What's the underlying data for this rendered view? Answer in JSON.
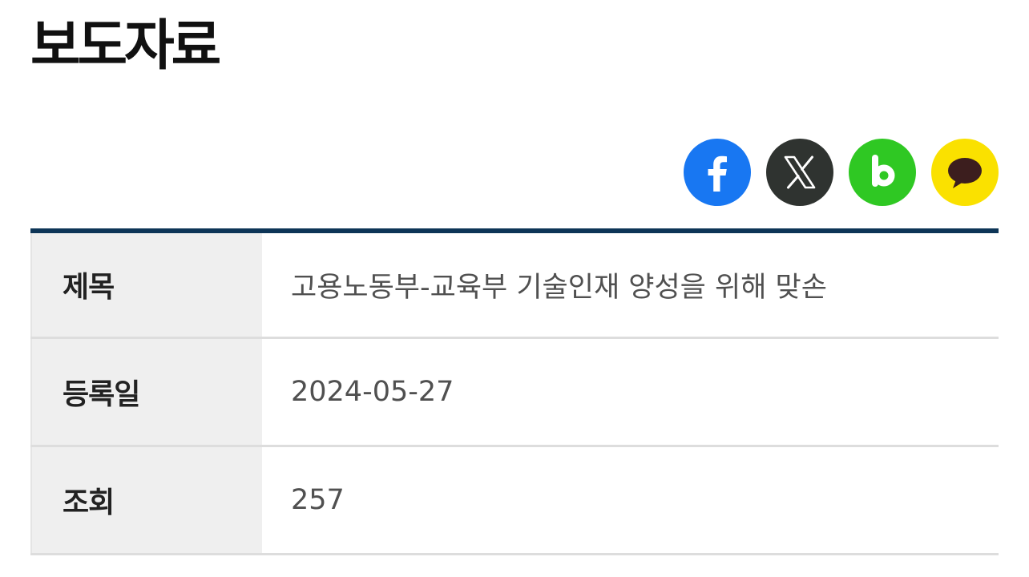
{
  "page": {
    "title": "보도자료"
  },
  "share": {
    "buttons": [
      {
        "name": "facebook",
        "icon": "facebook-icon",
        "color": "#1877f2"
      },
      {
        "name": "x",
        "icon": "x-icon",
        "color": "#2f3330"
      },
      {
        "name": "band",
        "icon": "band-icon",
        "color": "#2fc823"
      },
      {
        "name": "kakaotalk",
        "icon": "kakaotalk-icon",
        "color": "#fae100"
      }
    ]
  },
  "article": {
    "rows": [
      {
        "label": "제목",
        "value": "고용노동부-교육부 기술인재 양성을 위해 맞손"
      },
      {
        "label": "등록일",
        "value": "2024-05-27"
      },
      {
        "label": "조회",
        "value": "257"
      }
    ]
  },
  "colors": {
    "table_top_border": "#0d3557",
    "label_background": "#efefef"
  }
}
